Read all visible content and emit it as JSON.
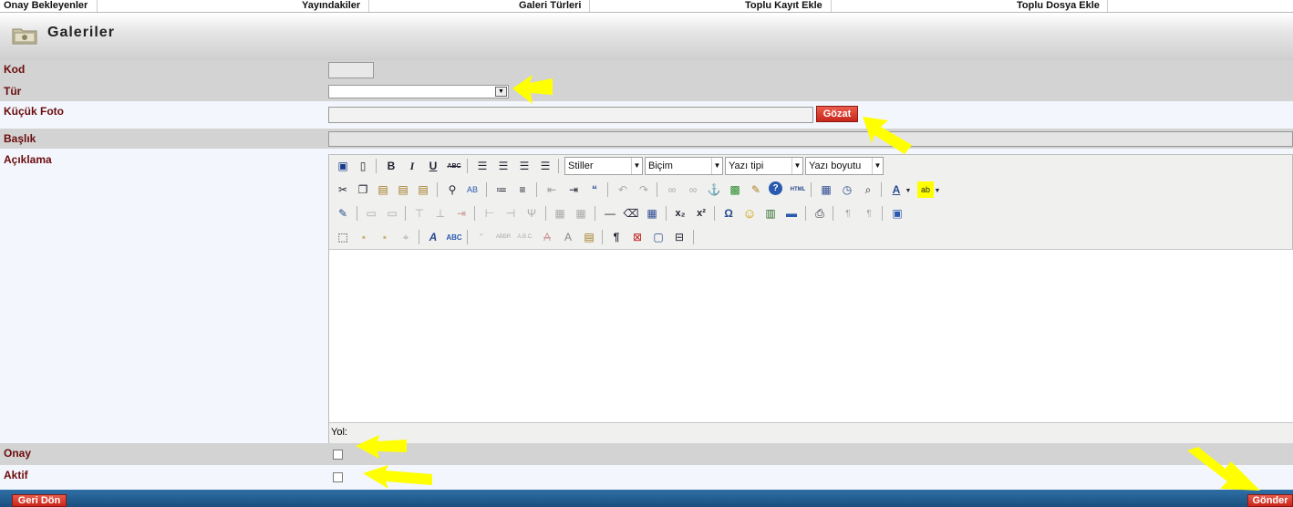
{
  "nav": {
    "items": [
      "Onay Bekleyenler",
      "Yayındakiler",
      "Galeri Türleri",
      "Toplu Kayıt Ekle",
      "Toplu Dosya Ekle"
    ]
  },
  "header": {
    "title": "Galeriler",
    "icon": "folder-icon"
  },
  "form": {
    "kod_label": "Kod",
    "tur_label": "Tür",
    "kucuk_foto_label": "Küçük Foto",
    "browse_label": "Gözat",
    "baslik_label": "Başlık",
    "aciklama_label": "Açıklama",
    "onay_label": "Onay",
    "aktif_label": "Aktif"
  },
  "editor": {
    "combos": [
      "Stiller",
      "Biçim",
      "Yazı tipi",
      "Yazı boyutu"
    ],
    "path_label": "Yol:"
  },
  "footer": {
    "back_label": "Geri Dön",
    "submit_label": "Gönder"
  },
  "colors": {
    "label": "#6b0d0d",
    "button": "#d9382b",
    "arrow": "#ffff00",
    "footer_bar": "#1f5a8c"
  }
}
